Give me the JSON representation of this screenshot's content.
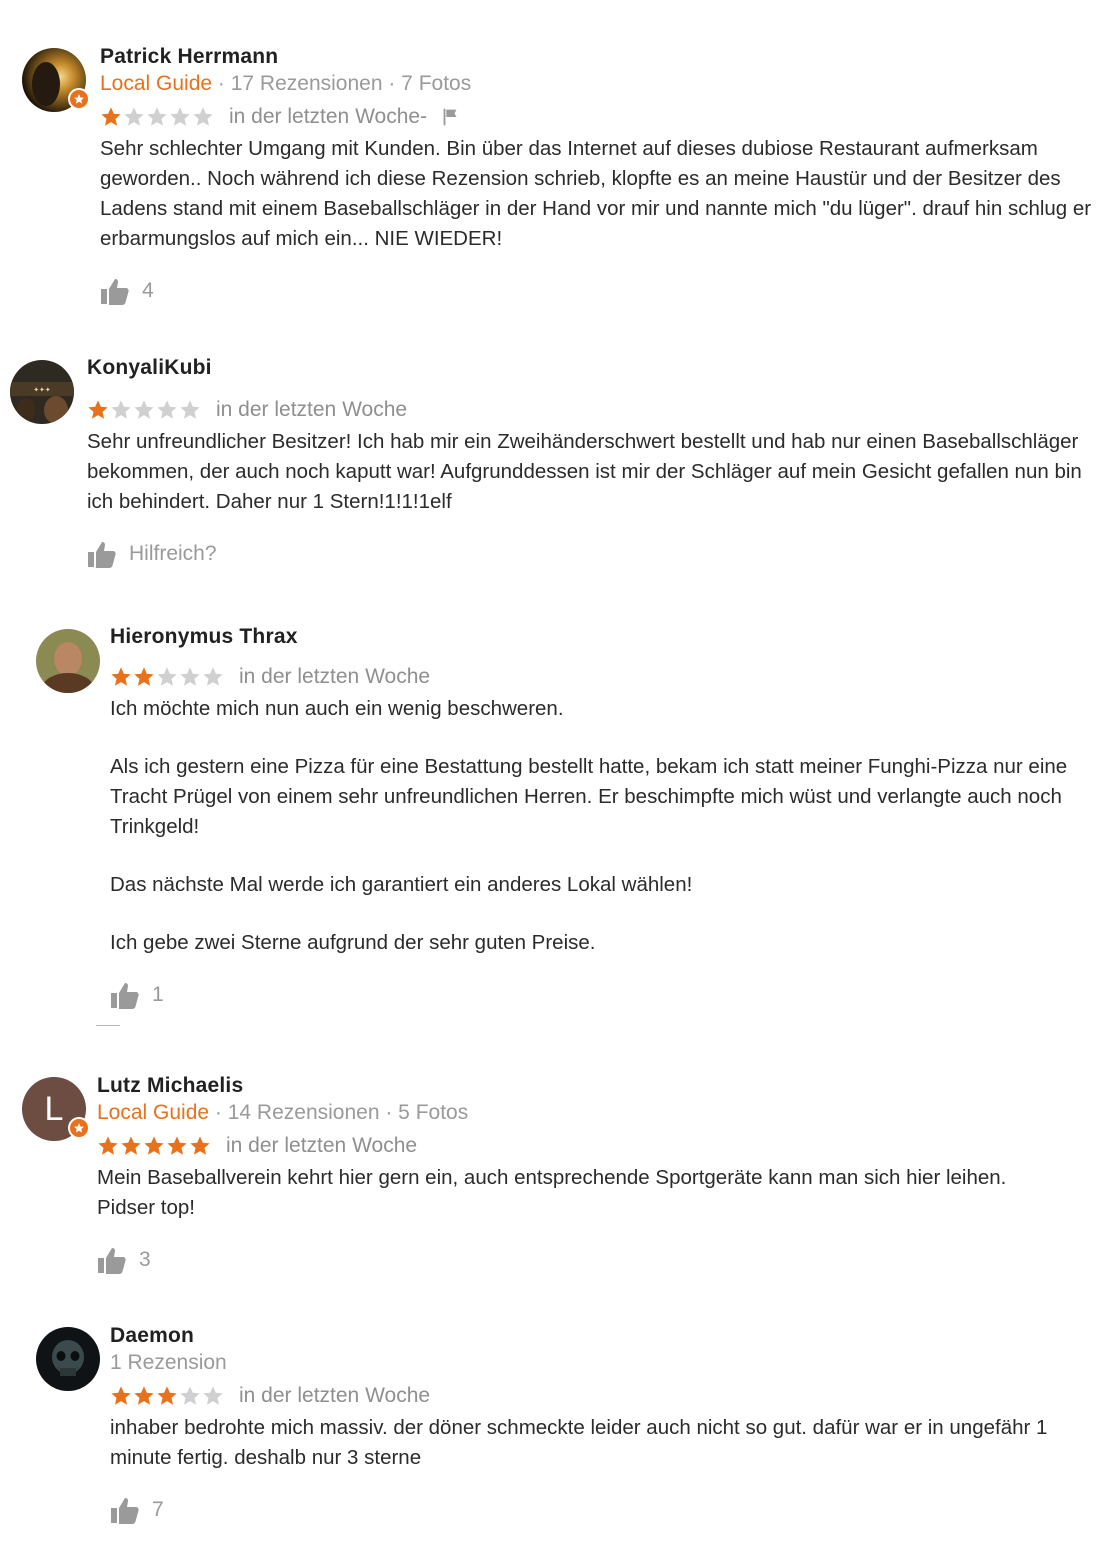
{
  "colors": {
    "accent": "#e8711c",
    "star_off": "#d0d0d0",
    "muted": "#9a9a9a"
  },
  "reviews": [
    {
      "name": "Patrick Herrmann",
      "guide_label": "Local Guide",
      "meta_rest": " · 17 Rezensionen · 7 Fotos",
      "rating": 1,
      "when": "in der letzten Woche",
      "when_suffix": " -",
      "text": [
        "Sehr schlechter Umgang mit Kunden. Bin über das Internet auf dieses dubiose Restaurant aufmerksam geworden.. Noch während ich diese Rezension schrieb, klopfte es an meine Haustür und der Besitzer des Ladens stand mit einem Baseballschläger in der Hand vor mir und nannte mich \"du lüger\". drauf hin schlug er erbarmungslos auf mich ein... NIE WIEDER!"
      ],
      "helpful": "4"
    },
    {
      "name": "KonyaliKubi",
      "rating": 1,
      "when": "in der letzten Woche",
      "text": [
        "Sehr unfreundlicher Besitzer! Ich hab mir ein Zweihänderschwert bestellt und hab nur einen Baseballschläger bekommen, der auch noch kaputt war! Aufgrunddessen ist mir der Schläger auf mein Gesicht gefallen nun bin ich behindert. Daher nur 1 Stern!1!1!1elf"
      ],
      "helpful": "Hilfreich?"
    },
    {
      "name": "Hieronymus Thrax",
      "rating": 2,
      "when": "in der letzten Woche",
      "text": [
        "Ich möchte mich nun auch ein wenig beschweren.",
        "Als ich gestern eine Pizza für eine Bestattung bestellt hatte, bekam ich statt meiner Funghi-Pizza nur eine Tracht Prügel von einem sehr unfreundlichen Herren. Er beschimpfte mich wüst und verlangte auch noch Trinkgeld!",
        "Das nächste Mal werde ich garantiert ein anderes Lokal wählen!",
        "Ich gebe zwei Sterne aufgrund der sehr guten Preise."
      ],
      "helpful": "1"
    },
    {
      "name": "Lutz Michaelis",
      "guide_label": "Local Guide",
      "meta_rest": " · 14 Rezensionen · 5 Fotos",
      "avatar_letter": "L",
      "rating": 5,
      "when": "in der letzten Woche",
      "text": [
        "Mein Baseballverein kehrt hier gern ein, auch entsprechende Sportgeräte kann man sich hier leihen. Pidser top!"
      ],
      "helpful": "3"
    },
    {
      "name": "Daemon",
      "meta_plain": "1 Rezension",
      "rating": 3,
      "when": "in der letzten Woche",
      "text": [
        "inhaber bedrohte mich massiv. der döner schmeckte leider auch nicht so gut. dafür war er in ungefähr 1 minute fertig. deshalb nur 3 sterne"
      ],
      "helpful": "7"
    }
  ]
}
